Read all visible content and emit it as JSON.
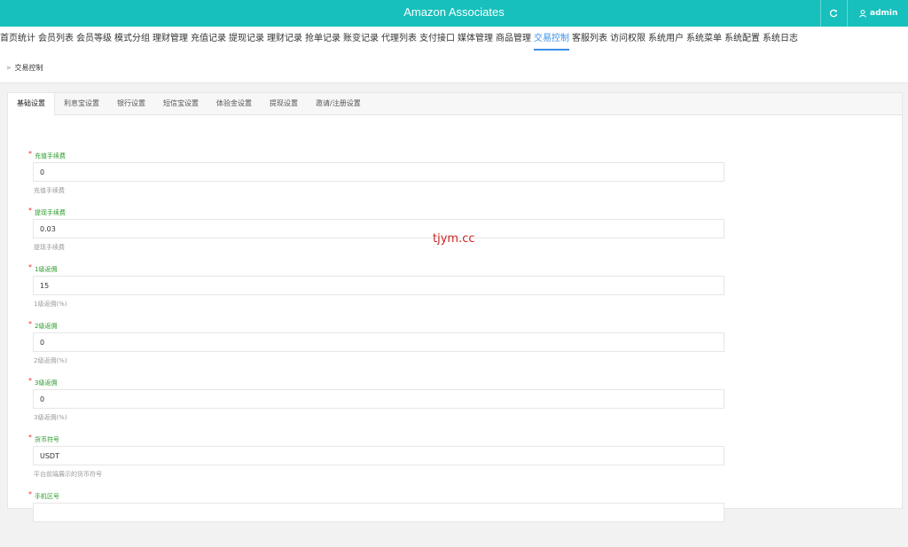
{
  "header": {
    "app_title": "Amazon Associates",
    "user": "admin",
    "refresh_icon": "refresh-icon",
    "user_icon": "user-icon"
  },
  "nav": {
    "items": [
      "首页统计",
      "会员列表",
      "会员等级",
      "模式分组",
      "理财管理",
      "充值记录",
      "提现记录",
      "理财记录",
      "抢单记录",
      "账变记录",
      "代理列表",
      "支付接口",
      "媒体管理",
      "商品管理",
      "交易控制",
      "客服列表",
      "访问权限",
      "系统用户",
      "系统菜单",
      "系统配置",
      "系统日志"
    ],
    "active": "交易控制"
  },
  "breadcrumb": {
    "separator": "»",
    "current": "交易控制"
  },
  "tabs": [
    "基础设置",
    "利息宝设置",
    "银行设置",
    "短信宝设置",
    "体验金设置",
    "提现设置",
    "邀请/注册设置"
  ],
  "active_tab": "基础设置",
  "form": {
    "required_mark": "*",
    "fields": [
      {
        "label": "充值手续费",
        "value": "0",
        "help": "充值手续费"
      },
      {
        "label": "提现手续费",
        "value": "0.03",
        "help": "提现手续费"
      },
      {
        "label": "1级返佣",
        "value": "15",
        "help": "1级返佣(%)"
      },
      {
        "label": "2级返佣",
        "value": "0",
        "help": "2级返佣(%)"
      },
      {
        "label": "3级返佣",
        "value": "0",
        "help": "3级返佣(%)"
      },
      {
        "label": "货币符号",
        "value": "USDT",
        "help": "平台前端展示的货币符号"
      },
      {
        "label": "手机区号",
        "value": "",
        "help": ""
      }
    ]
  },
  "watermark": "tjym.cc",
  "colors": {
    "header_bg": "#17c0bc",
    "nav_active": "#3a8fe8",
    "label_green": "#2a9a2a",
    "required_red": "#e33333"
  }
}
